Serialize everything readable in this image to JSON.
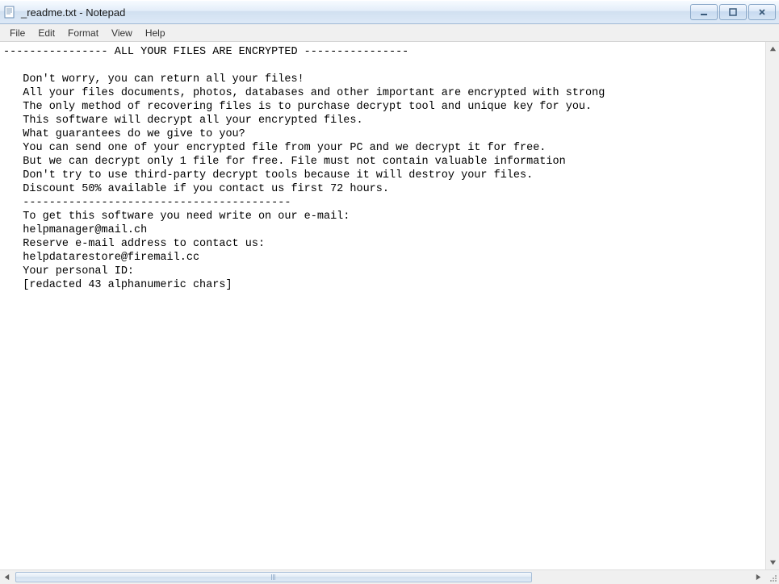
{
  "title": "_readme.txt - Notepad",
  "menu": {
    "file": "File",
    "edit": "Edit",
    "format": "Format",
    "view": "View",
    "help": "Help"
  },
  "content": "---------------- ALL YOUR FILES ARE ENCRYPTED ----------------\n\n   Don't worry, you can return all your files!\n   All your files documents, photos, databases and other important are encrypted with strong\n   The only method of recovering files is to purchase decrypt tool and unique key for you.\n   This software will decrypt all your encrypted files.\n   What guarantees do we give to you?\n   You can send one of your encrypted file from your PC and we decrypt it for free.\n   But we can decrypt only 1 file for free. File must not contain valuable information\n   Don't try to use third-party decrypt tools because it will destroy your files.\n   Discount 50% available if you contact us first 72 hours.\n   -----------------------------------------\n   To get this software you need write on our e-mail:\n   helpmanager@mail.ch\n   Reserve e-mail address to contact us:\n   helpdatarestore@firemail.cc\n   Your personal ID:\n   [redacted 43 alphanumeric chars]"
}
